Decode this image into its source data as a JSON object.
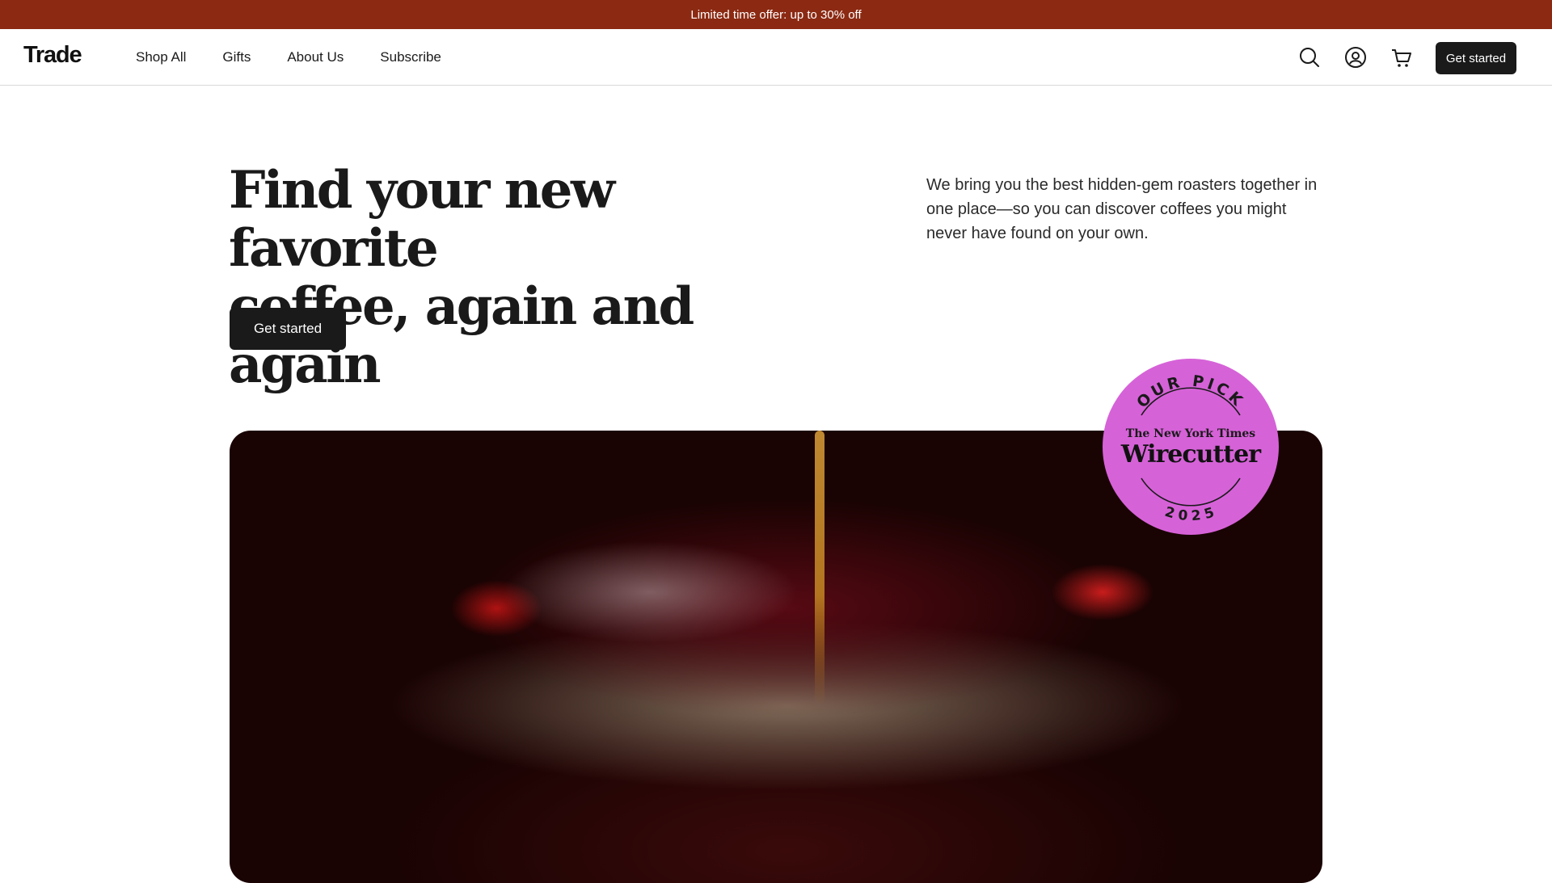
{
  "announcement": {
    "text": "Limited time offer: up to 30% off"
  },
  "header": {
    "logo": "Trade",
    "nav": [
      "Shop All",
      "Gifts",
      "About Us",
      "Subscribe"
    ],
    "icons": [
      "search-icon",
      "account-icon",
      "cart-icon"
    ],
    "cta_label": "Get started"
  },
  "hero": {
    "title_line1": "Find your new favorite",
    "title_line2": "coffee, again and again",
    "description": "We bring you the best hidden-gem roasters together in one place—so you can discover coffees you might never have found on your own.",
    "cta_label": "Get started"
  },
  "badge": {
    "top": "OUR PICK",
    "publisher": "The New York Times",
    "brand": "Wirecutter",
    "year": "2025"
  },
  "colors": {
    "announcement_bg": "#8b2912",
    "button_bg": "#1a1a1a",
    "badge_bg": "#d662d8"
  }
}
